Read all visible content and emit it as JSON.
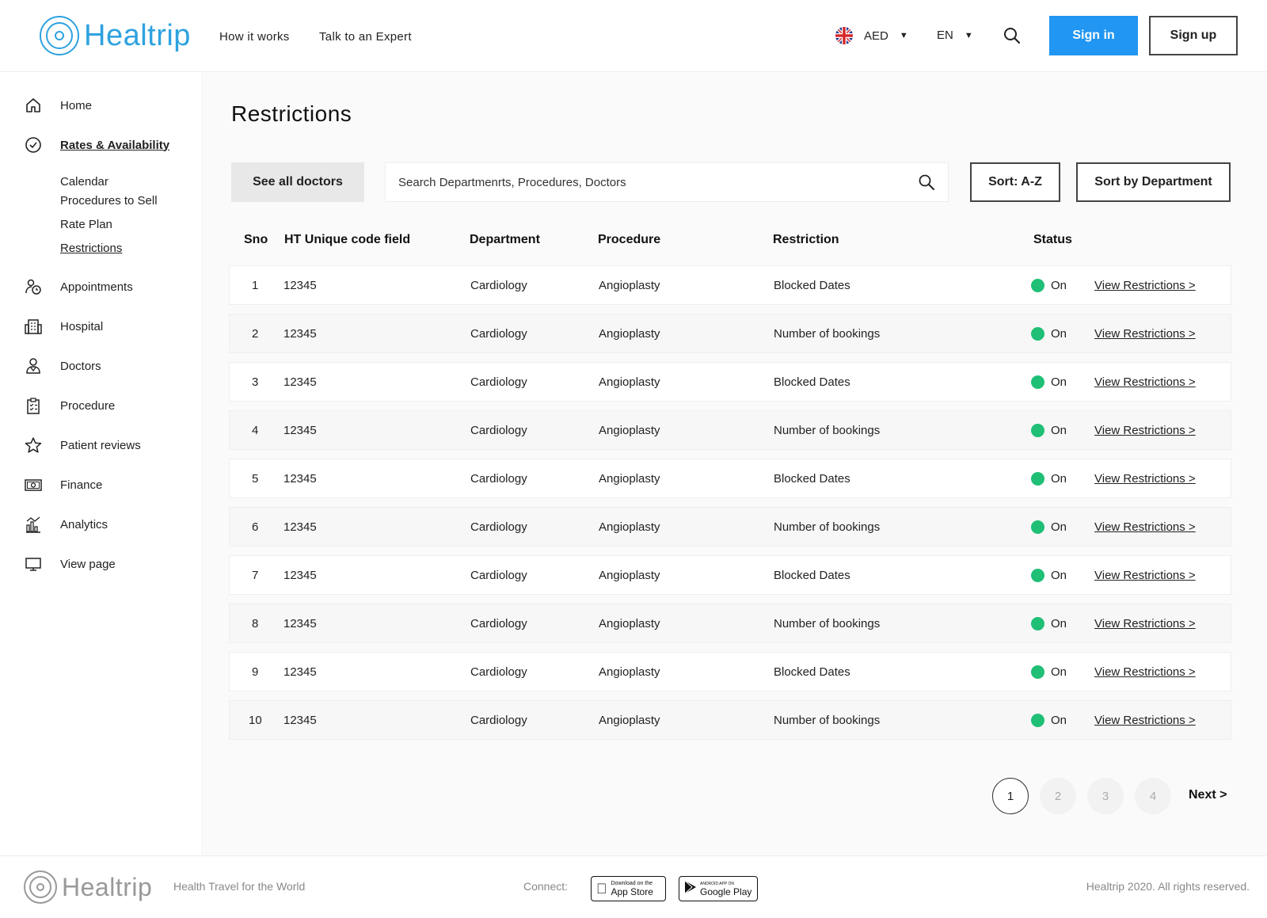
{
  "header": {
    "logo_text": "Healtrip",
    "nav": [
      "How it works",
      "Talk to an Expert"
    ],
    "currency": "AED",
    "language": "EN",
    "signin_label": "Sign in",
    "signup_label": "Sign up",
    "colors": {
      "brand": "#2ea2e0",
      "primary_button": "#2196f3"
    }
  },
  "sidebar": {
    "items": [
      {
        "label": "Home",
        "icon": "home-icon"
      },
      {
        "label": "Rates & Availability",
        "icon": "check-circle-icon",
        "active": true
      },
      {
        "label": "Appointments",
        "icon": "user-clock-icon"
      },
      {
        "label": "Hospital",
        "icon": "building-icon"
      },
      {
        "label": "Doctors",
        "icon": "doctor-icon"
      },
      {
        "label": "Procedure",
        "icon": "clipboard-icon"
      },
      {
        "label": "Patient reviews",
        "icon": "star-icon"
      },
      {
        "label": "Finance",
        "icon": "money-icon"
      },
      {
        "label": "Analytics",
        "icon": "bar-chart-icon"
      },
      {
        "label": "View page",
        "icon": "monitor-icon"
      }
    ],
    "subitems": [
      {
        "label": "Calendar"
      },
      {
        "label": "Procedures to Sell"
      },
      {
        "label": "Rate Plan"
      },
      {
        "label": "Restrictions",
        "active": true
      }
    ]
  },
  "main": {
    "title": "Restrictions",
    "see_all_label": "See all doctors",
    "search_placeholder": "Search Departmenrts, Procedures, Doctors",
    "sort_az_label": "Sort: A-Z",
    "sort_dept_label": "Sort by Department",
    "columns": [
      "Sno",
      "HT Unique code field",
      "Department",
      "Procedure",
      "Restriction",
      "Status"
    ],
    "rows": [
      {
        "sno": "1",
        "code": "12345",
        "department": "Cardiology",
        "procedure": "Angioplasty",
        "restriction": "Blocked Dates",
        "status": "On",
        "link": "View Restrictions >"
      },
      {
        "sno": "2",
        "code": "12345",
        "department": "Cardiology",
        "procedure": "Angioplasty",
        "restriction": "Number of bookings",
        "status": "On",
        "link": "View Restrictions >"
      },
      {
        "sno": "3",
        "code": "12345",
        "department": "Cardiology",
        "procedure": "Angioplasty",
        "restriction": "Blocked Dates",
        "status": "On",
        "link": "View Restrictions >"
      },
      {
        "sno": "4",
        "code": "12345",
        "department": "Cardiology",
        "procedure": "Angioplasty",
        "restriction": "Number of bookings",
        "status": "On",
        "link": "View Restrictions >"
      },
      {
        "sno": "5",
        "code": "12345",
        "department": "Cardiology",
        "procedure": "Angioplasty",
        "restriction": "Blocked Dates",
        "status": "On",
        "link": "View Restrictions >"
      },
      {
        "sno": "6",
        "code": "12345",
        "department": "Cardiology",
        "procedure": "Angioplasty",
        "restriction": "Number of bookings",
        "status": "On",
        "link": "View Restrictions >"
      },
      {
        "sno": "7",
        "code": "12345",
        "department": "Cardiology",
        "procedure": "Angioplasty",
        "restriction": "Blocked Dates",
        "status": "On",
        "link": "View Restrictions >"
      },
      {
        "sno": "8",
        "code": "12345",
        "department": "Cardiology",
        "procedure": "Angioplasty",
        "restriction": "Number of bookings",
        "status": "On",
        "link": "View Restrictions >"
      },
      {
        "sno": "9",
        "code": "12345",
        "department": "Cardiology",
        "procedure": "Angioplasty",
        "restriction": "Blocked Dates",
        "status": "On",
        "link": "View Restrictions >"
      },
      {
        "sno": "10",
        "code": "12345",
        "department": "Cardiology",
        "procedure": "Angioplasty",
        "restriction": "Number of bookings",
        "status": "On",
        "link": "View Restrictions >"
      }
    ],
    "status_color": "#1fbf75",
    "pagination": {
      "pages": [
        "1",
        "2",
        "3",
        "4"
      ],
      "current": "1",
      "next_label": "Next >"
    }
  },
  "footer": {
    "logo_text": "Healtrip",
    "tagline": "Health Travel for the World",
    "connect_label": "Connect:",
    "app_store": {
      "small": "Download on the",
      "big": "App Store"
    },
    "google_play": {
      "small": "ANDROID APP ON",
      "big": "Google Play"
    },
    "copyright": "Healtrip 2020. All rights reserved."
  }
}
